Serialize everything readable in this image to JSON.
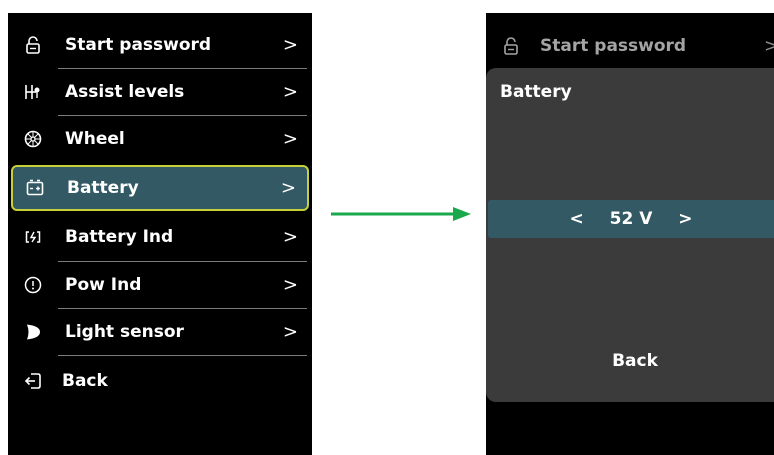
{
  "left_menu": {
    "items": [
      {
        "label": "Start password",
        "icon": "unlock-icon"
      },
      {
        "label": "Assist levels",
        "icon": "assist-levels-icon"
      },
      {
        "label": "Wheel",
        "icon": "wheel-icon"
      },
      {
        "label": "Battery",
        "icon": "battery-icon",
        "selected": true
      },
      {
        "label": "Battery Ind",
        "icon": "battery-indicator-icon"
      },
      {
        "label": "Pow Ind",
        "icon": "power-indicator-icon"
      },
      {
        "label": "Light sensor",
        "icon": "light-sensor-icon"
      },
      {
        "label": "Back",
        "icon": "exit-icon"
      }
    ],
    "chevron": ">"
  },
  "right_screen": {
    "top_item": {
      "label": "Start password",
      "icon": "unlock-icon",
      "chevron": ">"
    },
    "dialog": {
      "title": "Battery",
      "prev": "<",
      "value": "52 V",
      "next": ">",
      "back_label": "Back"
    }
  },
  "colors": {
    "screen_bg": "#000000",
    "selected_bg": "#335964",
    "selected_border": "#c7cf39",
    "dialog_bg": "#3b3b3b",
    "arrow": "#1aa84c"
  }
}
